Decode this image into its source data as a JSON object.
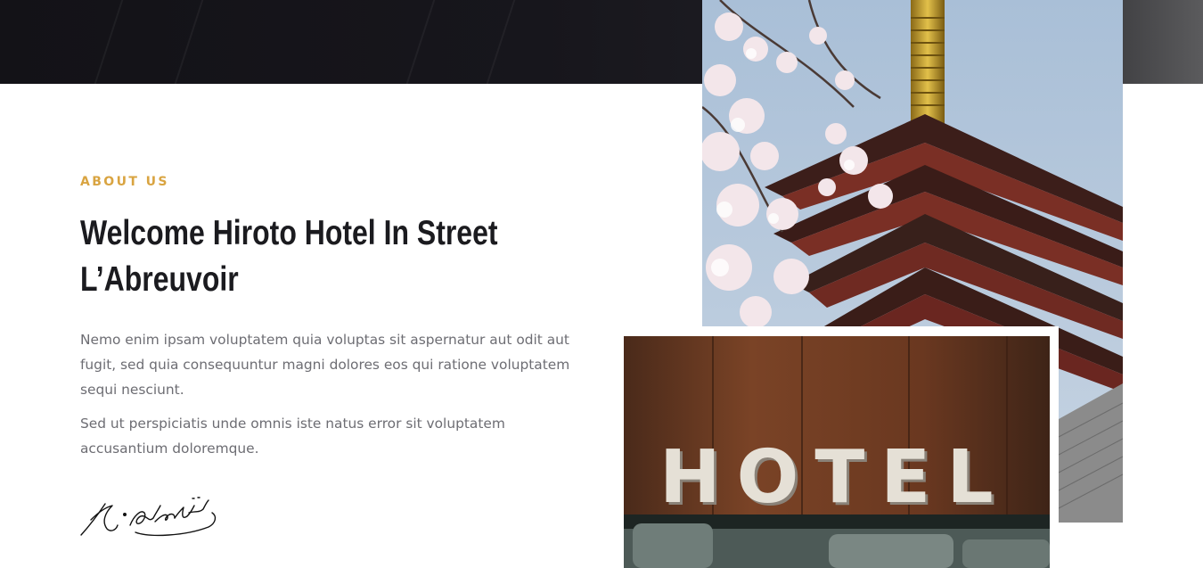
{
  "about": {
    "tag": "ABOUT US",
    "headline_line1": "Welcome Hiroto Hotel In Street",
    "headline_line2": "L’Abreuvoir",
    "paragraph_1": "Nemo enim ipsam voluptatem quia voluptas sit aspernatur aut odit aut fugit, sed quia consequuntur magni dolores eos qui ratione voluptatem sequi nesciunt.",
    "paragraph_2": "Sed ut perspiciatis unde omnis iste natus error sit voluptatem accusantium doloremque.",
    "signature_text": "K. Ataturk"
  },
  "images": {
    "hotel_sign_letters": [
      "H",
      "O",
      "T",
      "E",
      "L"
    ]
  },
  "colors": {
    "accent": "#d9a441",
    "heading": "#1b1b1f",
    "body_text": "#6d6d73",
    "top_band": "#131217"
  }
}
